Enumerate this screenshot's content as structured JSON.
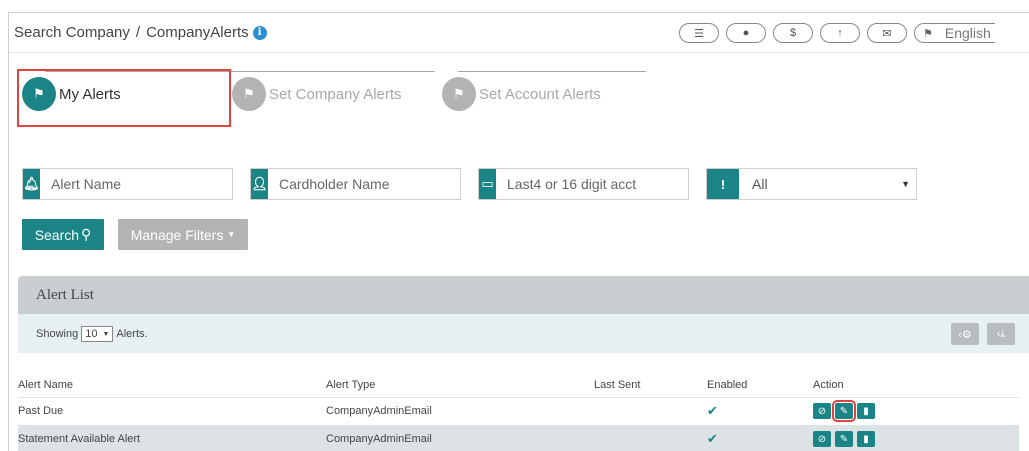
{
  "breadcrumb": {
    "root": "Search Company",
    "separator": "/",
    "current": "CompanyAlerts"
  },
  "header": {
    "icons": [
      "checklist-icon",
      "user-icon",
      "dollar-icon",
      "upload-icon",
      "mail-icon",
      "flag-icon"
    ],
    "language": "English"
  },
  "tabs": [
    {
      "label": "My Alerts",
      "state": "active"
    },
    {
      "label": "Set Company Alerts",
      "state": "inactive"
    },
    {
      "label": "Set Account Alerts",
      "state": "inactive"
    }
  ],
  "filters": {
    "alert_name_placeholder": "Alert Name",
    "cardholder_placeholder": "Cardholder Name",
    "account_placeholder": "Last4 or 16 digit acct",
    "status_value": "All"
  },
  "buttons": {
    "search": "Search",
    "manage_filters": "Manage Filters"
  },
  "panel": {
    "title": "Alert List",
    "showing_prefix": "Showing",
    "page_size": "10",
    "showing_suffix": "Alerts."
  },
  "table": {
    "columns": [
      "Alert Name",
      "Alert Type",
      "Last Sent",
      "Enabled",
      "Action"
    ],
    "rows": [
      {
        "name": "Past Due",
        "type": "CompanyAdminEmail",
        "last_sent": "",
        "enabled": "✔"
      },
      {
        "name": "Statement Available Alert",
        "type": "CompanyAdminEmail",
        "last_sent": "",
        "enabled": "✔"
      }
    ]
  },
  "colors": {
    "accent": "#1b8486",
    "inactive": "#b3b3b3",
    "highlight": "#e0443f"
  }
}
